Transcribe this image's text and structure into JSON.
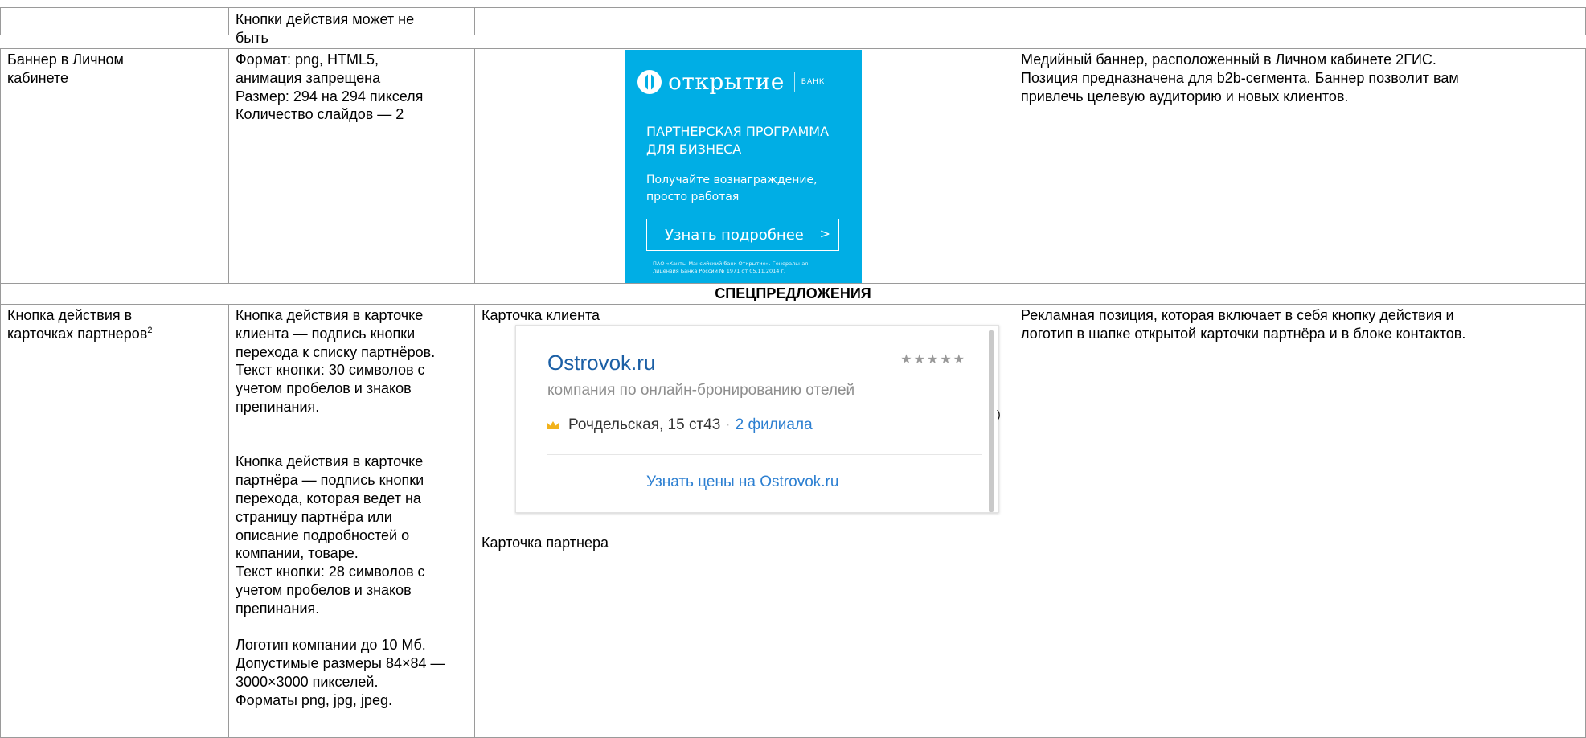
{
  "table": {
    "row0": {
      "desc": "Кнопки действия может не\nбыть"
    },
    "row1": {
      "name": "Баннер в Личном\nкабинете",
      "specs": "Формат: png, HTML5,\nанимация запрещена\nРазмер: 294 на 294 пикселя\nКоличество слайдов — 2",
      "info": "Медийный баннер, расположенный в Личном кабинете 2ГИС.\nПозиция предназначена для b2b-сегмента. Баннер позволит вам\nпривлечь целевую аудиторию и новых клиентов."
    },
    "section": "СПЕЦПРЕДЛОЖЕНИЯ",
    "row2": {
      "name": "Кнопка действия в\nкарточках партнеров",
      "name_footnote": "2",
      "specs": "Кнопка действия в карточке\nклиента — подпись кнопки\nперехода к списку партнёров.\nТекст кнопки: 30 символов с\nучетом пробелов и знаков\nпрепинания.\n\n\nКнопка действия в карточке\nпартнёра — подпись кнопки\nперехода, которая ведет на\nстраницу партнёра или\nописание подробностей о\nкомпании, товаре.\nТекст кнопки: 28 символов с\nучетом пробелов и знаков\nпрепинания.\n\nЛоготип компании до 10 Мб.\nДопустимые размеры 84×84 —\n3000×3000 пикселей.\nФорматы png, jpg, jpeg.",
      "client_card_label": "Карточка клиента",
      "partner_card_label": "Карточка партнера",
      "info": "Рекламная позиция, которая включает в себя кнопку действия и\nлоготип в шапке открытой карточки партнёра и в блоке контактов."
    }
  },
  "banner": {
    "logo_text": "открытие",
    "logo_sub": "БАНК",
    "title": "ПАРТНЕРСКАЯ ПРОГРАММА\nДЛЯ БИЗНЕСА",
    "text": "Получайте вознаграждение,\nпросто работая",
    "button": "Узнать подробнее",
    "button_icon": "chevron-right-icon",
    "legal": "ПАО «Ханты-Мансийский банк Открытие». Генеральная\nлицензия Банка России № 1971 от 05.11.2014 г.",
    "color": "#00aee5"
  },
  "client_card": {
    "title": "Ostrovok.ru",
    "stars": "★★★★★",
    "description": "компания по онлайн-бронированию отелей",
    "address": "Рочдельская, 15 ст43",
    "separator": "·",
    "branches": "2 филиала",
    "action": "Узнать цены на Ostrovok.ru",
    "side_mark": ")"
  }
}
